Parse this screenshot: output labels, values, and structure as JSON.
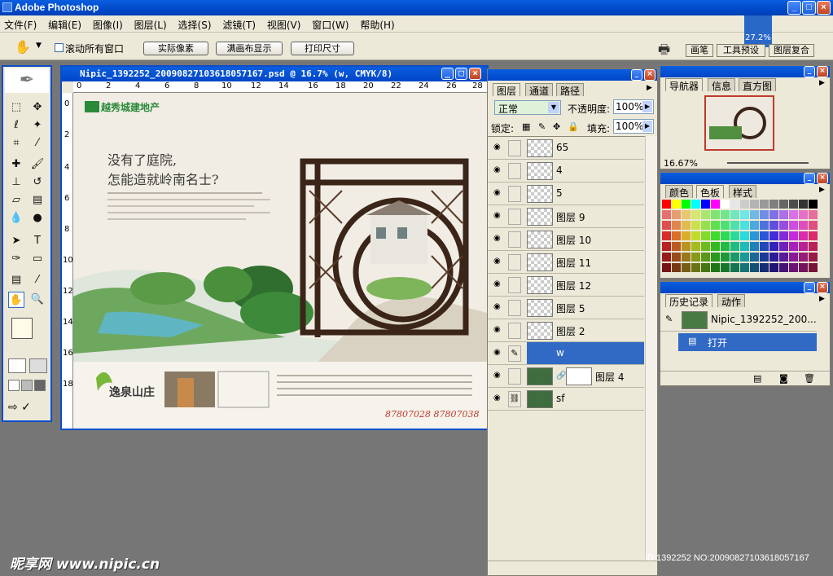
{
  "app": {
    "title": "Adobe Photoshop",
    "zoom_badge": "27.2%"
  },
  "menu": [
    "文件(F)",
    "编辑(E)",
    "图像(I)",
    "图层(L)",
    "选择(S)",
    "滤镜(T)",
    "视图(V)",
    "窗口(W)",
    "帮助(H)"
  ],
  "options": {
    "scroll_all_label": "滚动所有窗口",
    "actual_pixels": "实际像素",
    "fit_screen": "满画布显示",
    "print_size": "打印尺寸"
  },
  "dock_tabs": [
    "画笔",
    "工具预设",
    "图层复合"
  ],
  "document": {
    "title": "Nipic_1392252_20090827103618057167.psd @ 16.7% (w, CMYK/8)",
    "ruler_h": [
      "0",
      "2",
      "4",
      "6",
      "8",
      "10",
      "12",
      "14",
      "16",
      "18",
      "20",
      "22",
      "24",
      "26",
      "28"
    ],
    "ruler_v": [
      "0",
      "2",
      "4",
      "6",
      "8",
      "10",
      "12",
      "14",
      "16",
      "18"
    ],
    "ad": {
      "brand": "越秀城建地产",
      "headline1": "没有了庭院,",
      "headline2": "怎能造就岭南名士?",
      "body": "华南园林建筑新风格 大境泽城市 粤韵风采永融居 领略尽显 今岁看今 双实参 流融人际 自然 园林 舒适境地",
      "logo_text": "逸泉山庄",
      "phone": "87807028  87807038"
    }
  },
  "layers_panel": {
    "tabs": [
      "图层",
      "通道",
      "路径"
    ],
    "blend_mode": "正常",
    "opacity_label": "不透明度:",
    "opacity": "100%",
    "lock_label": "锁定:",
    "fill_label": "填充:",
    "fill": "100%",
    "layers": [
      {
        "name": "65",
        "selected": false
      },
      {
        "name": "4",
        "selected": false
      },
      {
        "name": "5",
        "selected": false
      },
      {
        "name": "图层 9",
        "selected": false
      },
      {
        "name": "图层 10",
        "selected": false
      },
      {
        "name": "图层 11",
        "selected": false
      },
      {
        "name": "图层 12",
        "selected": false
      },
      {
        "name": "图层 5",
        "selected": false
      },
      {
        "name": "图层 2",
        "selected": false
      },
      {
        "name": "w",
        "selected": true
      },
      {
        "name": "图层 4",
        "selected": false
      },
      {
        "name": "sf",
        "selected": false
      }
    ]
  },
  "navigator": {
    "tabs": [
      "导航器",
      "信息",
      "直方图"
    ],
    "zoom": "16.67%"
  },
  "swatches": {
    "tabs": [
      "颜色",
      "色板",
      "样式"
    ]
  },
  "history": {
    "tabs": [
      "历史记录",
      "动作"
    ],
    "snapshot": "Nipic_1392252_200...",
    "step": "打开"
  },
  "watermark": "昵享网 www.nipic.cn",
  "footer_id": "ID:1392252 NO:20090827103618057167"
}
